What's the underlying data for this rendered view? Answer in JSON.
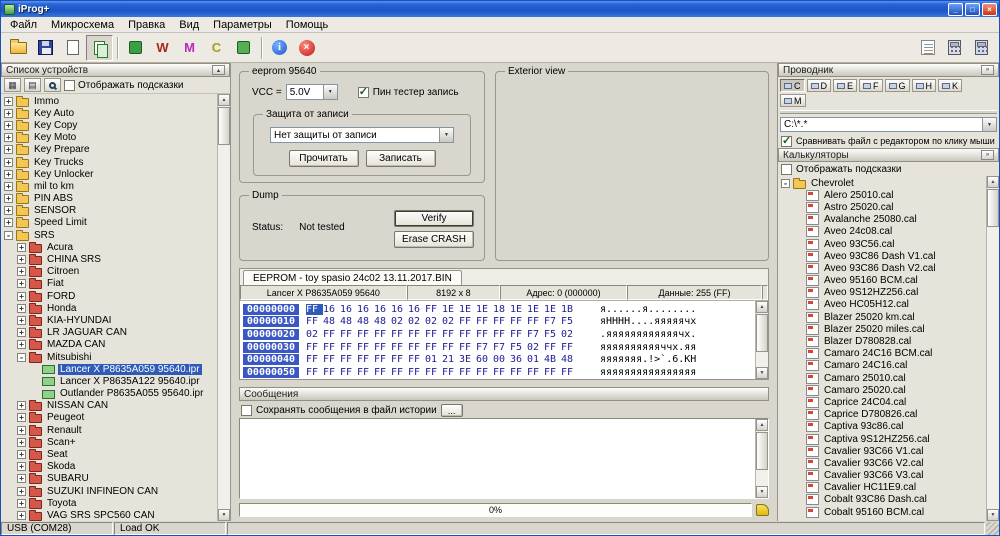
{
  "window": {
    "title": "iProg+"
  },
  "titlebar": {
    "minimize_glyph": "_",
    "maximize_glyph": "□",
    "close_glyph": "×"
  },
  "icons": {
    "chevron_down": "▼",
    "chevron_right": "»",
    "collapse": "▴",
    "scroll_up": "▲",
    "scroll_down": "▼",
    "grid": "▦",
    "list": "▤"
  },
  "colors": {
    "titlebar_blue": "#2764d8",
    "selection_blue": "#2f5bb7",
    "folder_yellow": "#f4c654",
    "folder_red": "#d6564a",
    "hex_value_navy": "#1c1c96"
  },
  "menu": [
    {
      "name": "menu-file",
      "label": "Файл"
    },
    {
      "name": "menu-microchip",
      "label": "Микросхема"
    },
    {
      "name": "menu-edit",
      "label": "Правка"
    },
    {
      "name": "menu-view",
      "label": "Вид"
    },
    {
      "name": "menu-parameters",
      "label": "Параметры"
    },
    {
      "name": "menu-help",
      "label": "Помощь"
    }
  ],
  "toolbar": {
    "items": [
      {
        "name": "open-button",
        "kind": "folder"
      },
      {
        "name": "save-button",
        "kind": "floppy"
      },
      {
        "name": "new-button",
        "kind": "page"
      },
      {
        "name": "copy-buffer-button",
        "kind": "copy",
        "pressed": true
      },
      {
        "kind": "sep"
      },
      {
        "name": "chip-green-button",
        "kind": "chip",
        "color": "#3aa045"
      },
      {
        "name": "chip-w-button",
        "kind": "letter",
        "glyph": "W",
        "color": "#a52a18"
      },
      {
        "name": "chip-m-button",
        "kind": "letter",
        "glyph": "M",
        "color": "#bc28bc"
      },
      {
        "name": "chip-c-button",
        "kind": "letter",
        "glyph": "C",
        "color": "#a8a012"
      },
      {
        "name": "chip-green2-button",
        "kind": "chip",
        "color": "#55b055"
      },
      {
        "kind": "sep"
      },
      {
        "name": "info-button",
        "kind": "info",
        "glyph": "i"
      },
      {
        "name": "stop-button",
        "kind": "stop",
        "glyph": "×"
      }
    ],
    "right_items": [
      {
        "name": "notes-button",
        "kind": "note"
      },
      {
        "name": "calculator-button",
        "kind": "calc"
      },
      {
        "name": "keypad-button",
        "kind": "keypad"
      }
    ]
  },
  "left_panel": {
    "title": "Список устройств",
    "tooltips_label": "Отображать подсказки",
    "tooltips_checked": false,
    "tree": [
      {
        "level": 0,
        "expand": "+",
        "icon": "folder",
        "label": "Immo"
      },
      {
        "level": 0,
        "expand": "+",
        "icon": "folder",
        "label": "Key Auto"
      },
      {
        "level": 0,
        "expand": "+",
        "icon": "folder",
        "label": "Key Copy"
      },
      {
        "level": 0,
        "expand": "+",
        "icon": "folder",
        "label": "Key Moto"
      },
      {
        "level": 0,
        "expand": "+",
        "icon": "folder",
        "label": "Key Prepare"
      },
      {
        "level": 0,
        "expand": "+",
        "icon": "folder",
        "label": "Key Trucks"
      },
      {
        "level": 0,
        "expand": "+",
        "icon": "folder",
        "label": "Key Unlocker"
      },
      {
        "level": 0,
        "expand": "+",
        "icon": "folder",
        "label": "mil to km"
      },
      {
        "level": 0,
        "expand": "+",
        "icon": "folder",
        "label": "PIN ABS"
      },
      {
        "level": 0,
        "expand": "+",
        "icon": "folder",
        "label": "SENSOR"
      },
      {
        "level": 0,
        "expand": "+",
        "icon": "folder",
        "label": "Speed Limit"
      },
      {
        "level": 0,
        "expand": "-",
        "icon": "folder-open",
        "label": "SRS"
      },
      {
        "level": 1,
        "expand": "+",
        "icon": "folder-red",
        "label": "Acura"
      },
      {
        "level": 1,
        "expand": "+",
        "icon": "folder-red",
        "label": "CHINA SRS"
      },
      {
        "level": 1,
        "expand": "+",
        "icon": "folder-red",
        "label": "Citroen"
      },
      {
        "level": 1,
        "expand": "+",
        "icon": "folder-red",
        "label": "Fiat"
      },
      {
        "level": 1,
        "expand": "+",
        "icon": "folder-red",
        "label": "FORD"
      },
      {
        "level": 1,
        "expand": "+",
        "icon": "folder-red",
        "label": "Honda"
      },
      {
        "level": 1,
        "expand": "+",
        "icon": "folder-red",
        "label": "KIA-HYUNDAI"
      },
      {
        "level": 1,
        "expand": "+",
        "icon": "folder-red",
        "label": "LR JAGUAR CAN"
      },
      {
        "level": 1,
        "expand": "+",
        "icon": "folder-red",
        "label": "MAZDA CAN"
      },
      {
        "level": 1,
        "expand": "-",
        "icon": "folder-red-open",
        "label": "Mitsubishi"
      },
      {
        "level": 2,
        "icon": "chip",
        "label": "Lancer X P8635A059 95640.ipr",
        "selected": true
      },
      {
        "level": 2,
        "icon": "chip",
        "label": "Lancer X P8635A122 95640.ipr"
      },
      {
        "level": 2,
        "icon": "chip",
        "label": "Outlander P8635A055 95640.ipr"
      },
      {
        "level": 1,
        "expand": "+",
        "icon": "folder-red",
        "label": "NISSAN CAN"
      },
      {
        "level": 1,
        "expand": "+",
        "icon": "folder-red",
        "label": "Peugeot"
      },
      {
        "level": 1,
        "expand": "+",
        "icon": "folder-red",
        "label": "Renault"
      },
      {
        "level": 1,
        "expand": "+",
        "icon": "folder-red",
        "label": "Scan+"
      },
      {
        "level": 1,
        "expand": "+",
        "icon": "folder-red",
        "label": "Seat"
      },
      {
        "level": 1,
        "expand": "+",
        "icon": "folder-red",
        "label": "Skoda"
      },
      {
        "level": 1,
        "expand": "+",
        "icon": "folder-red",
        "label": "SUBARU"
      },
      {
        "level": 1,
        "expand": "+",
        "icon": "folder-red",
        "label": "SUZUKI INFINEON CAN"
      },
      {
        "level": 1,
        "expand": "+",
        "icon": "folder-red",
        "label": "Toyota"
      },
      {
        "level": 1,
        "expand": "+",
        "icon": "folder-red",
        "label": "VAG SRS SPC560 CAN"
      }
    ]
  },
  "device": {
    "group_title": "eeprom 95640",
    "vcc_label": "VCC =",
    "vcc_value": "5.0V",
    "pin_tester_label": "Пин тестер запись",
    "pin_tester_checked": true,
    "wp_group_title": "Защита от записи",
    "wp_value": "Нет защиты от записи",
    "read_label": "Прочитать",
    "write_label": "Записать"
  },
  "dump": {
    "title": "Dump",
    "status_label": "Status:",
    "status_value": "Not tested",
    "verify_label": "Verify",
    "erase_label": "Erase CRASH"
  },
  "exterior": {
    "title": "Exterior view"
  },
  "editor": {
    "tab": "EEPROM - toy spasio 24c02 13.11.2017.BIN",
    "chip": "Lancer X P8635A059 95640",
    "size": "8192 x 8",
    "address": "Адрес: 0 (000000)",
    "value": "Данные: 255 (FF)",
    "rows": [
      {
        "addr": "00000000",
        "bytes": [
          "FF",
          "16",
          "16",
          "16",
          "16",
          "16",
          "16",
          "FF",
          "1E",
          "1E",
          "1E",
          "18",
          "1E",
          "1E",
          "1E",
          "1B"
        ],
        "ascii": "я......я........"
      },
      {
        "addr": "00000010",
        "bytes": [
          "FF",
          "48",
          "48",
          "48",
          "48",
          "02",
          "02",
          "02",
          "02",
          "FF",
          "FF",
          "FF",
          "FF",
          "FF",
          "F7",
          "F5"
        ],
        "ascii": "яHHHH....яяяяячх"
      },
      {
        "addr": "00000020",
        "bytes": [
          "02",
          "FF",
          "FF",
          "FF",
          "FF",
          "FF",
          "FF",
          "FF",
          "FF",
          "FF",
          "FF",
          "FF",
          "FF",
          "F7",
          "F5",
          "02"
        ],
        "ascii": ".яяяяяяяяяяяячх."
      },
      {
        "addr": "00000030",
        "bytes": [
          "FF",
          "FF",
          "FF",
          "FF",
          "FF",
          "FF",
          "FF",
          "FF",
          "FF",
          "FF",
          "F7",
          "F7",
          "F5",
          "02",
          "FF",
          "FF"
        ],
        "ascii": "яяяяяяяяяяччх.яя"
      },
      {
        "addr": "00000040",
        "bytes": [
          "FF",
          "FF",
          "FF",
          "FF",
          "FF",
          "FF",
          "FF",
          "01",
          "21",
          "3E",
          "60",
          "00",
          "36",
          "01",
          "4B",
          "48"
        ],
        "ascii": "яяяяяяя.!>`.6.KH"
      },
      {
        "addr": "00000050",
        "bytes": [
          "FF",
          "FF",
          "FF",
          "FF",
          "FF",
          "FF",
          "FF",
          "FF",
          "FF",
          "FF",
          "FF",
          "FF",
          "FF",
          "FF",
          "FF",
          "FF"
        ],
        "ascii": "яяяяяяяяяяяяяяяя"
      }
    ]
  },
  "messages": {
    "title": "Сообщения",
    "save_label": "Сохранять сообщения в файл истории",
    "save_checked": false,
    "more_label": "...",
    "progress": "0%"
  },
  "right_panel": {
    "explorer_title": "Проводник",
    "drive_rows": [
      [
        "C",
        "D",
        "E",
        "F",
        "G",
        "H",
        "K"
      ],
      [
        "M"
      ]
    ],
    "active_drive": "C",
    "path": "C:\\*.*",
    "compare_label": "Сравнивать файл с редактором по клику мыши",
    "compare_checked": true,
    "calculators_title": "Калькуляторы",
    "tooltips_label": "Отображать подсказки",
    "tooltips_checked": false,
    "tree": [
      {
        "level": 0,
        "expand": "-",
        "icon": "folder-open",
        "label": "Chevrolet"
      },
      {
        "level": 1,
        "icon": "cal",
        "label": "Alero 25010.cal"
      },
      {
        "level": 1,
        "icon": "cal",
        "label": "Astro 25020.cal"
      },
      {
        "level": 1,
        "icon": "cal",
        "label": "Avalanche 25080.cal"
      },
      {
        "level": 1,
        "icon": "cal",
        "label": "Aveo 24c08.cal"
      },
      {
        "level": 1,
        "icon": "cal",
        "label": "Aveo 93C56.cal"
      },
      {
        "level": 1,
        "icon": "cal",
        "label": "Aveo 93C86 Dash V1.cal"
      },
      {
        "level": 1,
        "icon": "cal",
        "label": "Aveo 93C86 Dash V2.cal"
      },
      {
        "level": 1,
        "icon": "cal",
        "label": "Aveo 95160 BCM.cal"
      },
      {
        "level": 1,
        "icon": "cal",
        "label": "Aveo 9S12HZ256.cal"
      },
      {
        "level": 1,
        "icon": "cal",
        "label": "Aveo HC05H12.cal"
      },
      {
        "level": 1,
        "icon": "cal",
        "label": "Blazer 25020 km.cal"
      },
      {
        "level": 1,
        "icon": "cal",
        "label": "Blazer 25020 miles.cal"
      },
      {
        "level": 1,
        "icon": "cal",
        "label": "Blazer D780828.cal"
      },
      {
        "level": 1,
        "icon": "cal",
        "label": "Camaro 24C16 BCM.cal"
      },
      {
        "level": 1,
        "icon": "cal",
        "label": "Camaro 24C16.cal"
      },
      {
        "level": 1,
        "icon": "cal",
        "label": "Camaro 25010.cal"
      },
      {
        "level": 1,
        "icon": "cal",
        "label": "Camaro 25020.cal"
      },
      {
        "level": 1,
        "icon": "cal",
        "label": "Caprice 24C04.cal"
      },
      {
        "level": 1,
        "icon": "cal",
        "label": "Caprice D780826.cal"
      },
      {
        "level": 1,
        "icon": "cal",
        "label": "Captiva 93c86.cal"
      },
      {
        "level": 1,
        "icon": "cal",
        "label": "Captiva 9S12HZ256.cal"
      },
      {
        "level": 1,
        "icon": "cal",
        "label": "Cavalier 93C66 V1.cal"
      },
      {
        "level": 1,
        "icon": "cal",
        "label": "Cavalier 93C66 V2.cal"
      },
      {
        "level": 1,
        "icon": "cal",
        "label": "Cavalier 93C66 V3.cal"
      },
      {
        "level": 1,
        "icon": "cal",
        "label": "Cavalier HC11E9.cal"
      },
      {
        "level": 1,
        "icon": "cal",
        "label": "Cobalt 93C86 Dash.cal"
      },
      {
        "level": 1,
        "icon": "cal",
        "label": "Cobalt 95160 BCM.cal"
      }
    ]
  },
  "statusbar": {
    "left": "USB (COM28)",
    "right": "Load OK"
  }
}
